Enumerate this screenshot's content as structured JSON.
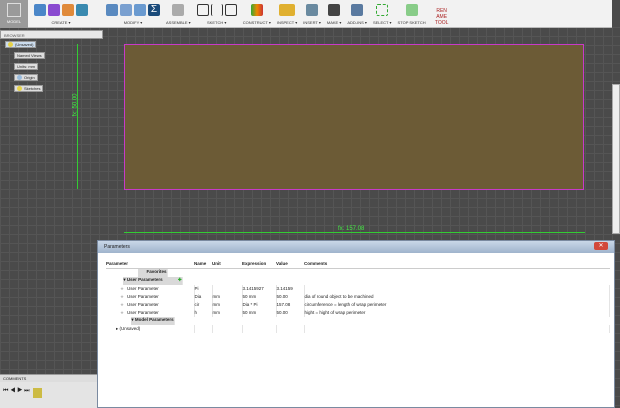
{
  "toolbar": {
    "model": "MODEL",
    "groups": [
      "CREATE ▾",
      "MODIFY ▾",
      "ASSEMBLE ▾",
      "SKETCH ▾",
      "CONSTRUCT ▾",
      "INSPECT ▾",
      "INSERT ▾",
      "MAKE ▾",
      "ADD-INS ▾",
      "SELECT ▾",
      "STOP SKETCH",
      "REN AME TOOL"
    ]
  },
  "browser": {
    "title": "BROWSER",
    "items": [
      "(Unsaved)",
      "Named Views",
      "Units: mm",
      "Origin",
      "Sketches"
    ]
  },
  "sketch": {
    "dim_height": "fx: 50.00",
    "dim_width": "fx: 157.08"
  },
  "dialog": {
    "title": "Parameters",
    "close": "✕",
    "headers": [
      "Parameter",
      "Name",
      "Unit",
      "Expression",
      "Value",
      "Comments"
    ],
    "favorites": "Favorites",
    "user_params": "User Parameters",
    "model_params": "Model Parameters",
    "unsaved": "(Unsaved)",
    "rows": [
      {
        "param": "User Parameter",
        "name": "Pi",
        "unit": "",
        "expr": "3.1415927",
        "value": "3.14159",
        "comment": ""
      },
      {
        "param": "User Parameter",
        "name": "Dia",
        "unit": "mm",
        "expr": "50 mm",
        "value": "50.00",
        "comment": "dia of round object to be machined"
      },
      {
        "param": "User Parameter",
        "name": "cir",
        "unit": "mm",
        "expr": "Dia * Pi",
        "value": "157.08",
        "comment": "circumference = length of wrap perimeter"
      },
      {
        "param": "User Parameter",
        "name": "h",
        "unit": "mm",
        "expr": "50 mm",
        "value": "50.00",
        "comment": "hight = hight of wrap perimeter"
      }
    ]
  },
  "comments": "COMMENTS",
  "timeline": {
    "controls": "⏮ ◀ ▶ ⏭"
  }
}
